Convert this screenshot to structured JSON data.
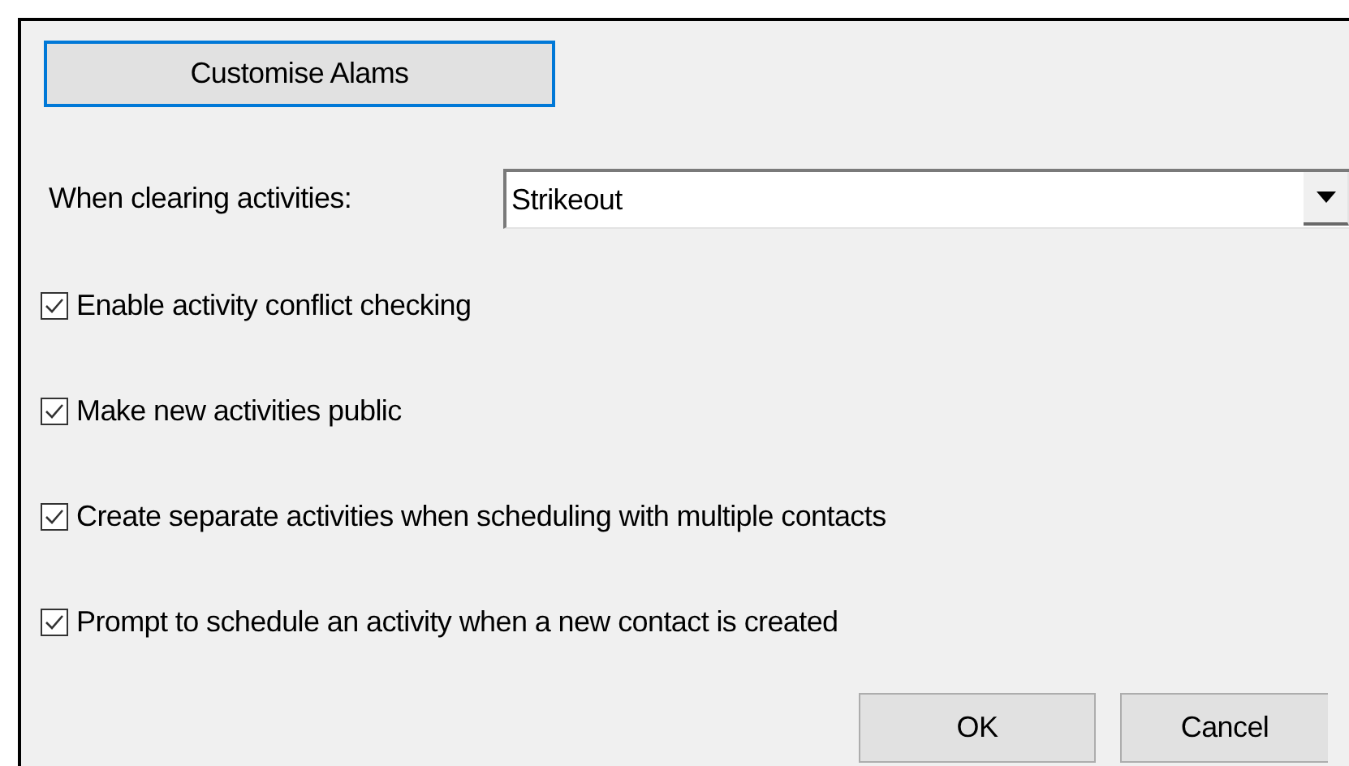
{
  "customise_button": {
    "label": "Customise Alams",
    "focused": true
  },
  "clearing": {
    "label": "When clearing activities:",
    "value": "Strikeout"
  },
  "options": [
    {
      "label": "Enable activity conflict checking",
      "checked": true
    },
    {
      "label": "Make new activities public",
      "checked": true
    },
    {
      "label": "Create separate activities when scheduling with multiple contacts",
      "checked": true
    },
    {
      "label": "Prompt to schedule an activity when a new contact is created",
      "checked": true
    }
  ],
  "buttons": [
    "OK",
    "Cancel"
  ]
}
